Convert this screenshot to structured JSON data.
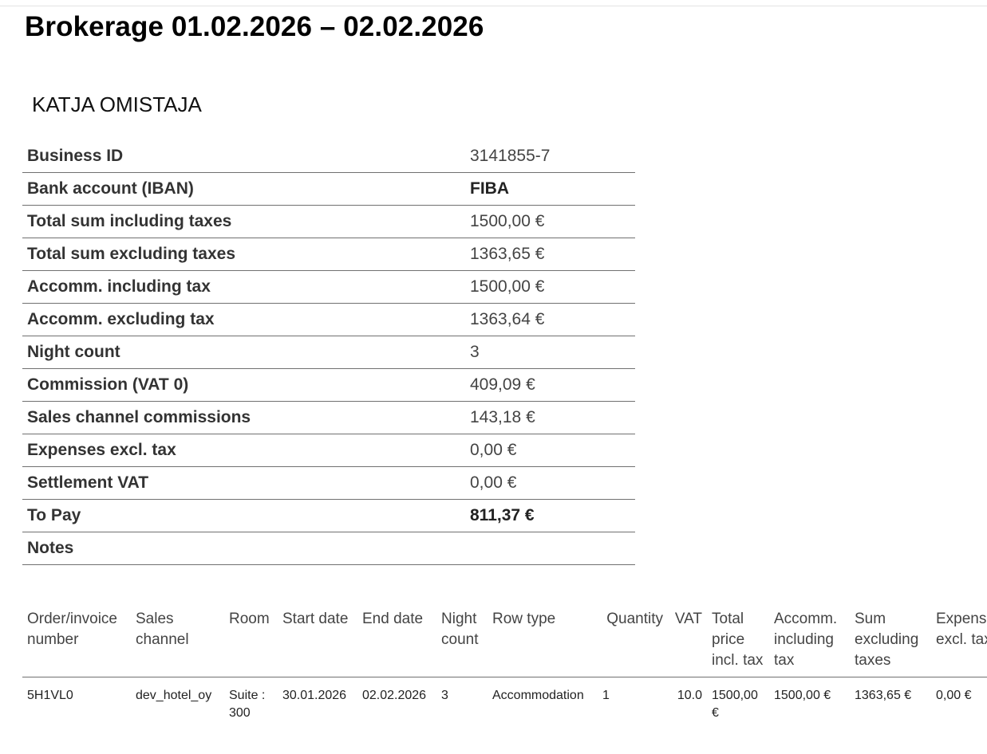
{
  "title": "Brokerage 01.02.2026 – 02.02.2026",
  "owner_name": "KATJA OMISTAJA",
  "summary": [
    {
      "label": "Business ID",
      "value": "3141855-7"
    },
    {
      "label": "Bank account (IBAN)",
      "value": "FIBA"
    },
    {
      "label": "Total sum including taxes",
      "value": "1500,00 €"
    },
    {
      "label": "Total sum excluding taxes",
      "value": "1363,65 €"
    },
    {
      "label": "Accomm. including tax",
      "value": "1500,00 €"
    },
    {
      "label": "Accomm. excluding tax",
      "value": "1363,64 €"
    },
    {
      "label": "Night count",
      "value": "3"
    },
    {
      "label": "Commission (VAT 0)",
      "value": "409,09 €"
    },
    {
      "label": "Sales channel commissions",
      "value": "143,18 €"
    },
    {
      "label": "Expenses excl. tax",
      "value": "0,00 €"
    },
    {
      "label": "Settlement VAT",
      "value": "0,00 €"
    },
    {
      "label": "To Pay",
      "value": "811,37 €"
    },
    {
      "label": "Notes",
      "value": ""
    }
  ],
  "rows_table": {
    "headers": [
      "Order/invoice number",
      "Sales channel",
      "Room",
      "Start date",
      "End date",
      "Night count",
      "Row type",
      "Quantity",
      "VAT",
      "Total price incl. tax",
      "Accomm. including tax",
      "Sum excluding taxes",
      "Expenses excl. tax"
    ],
    "rows": [
      [
        "5H1VL0",
        "dev_hotel_oy",
        "Suite : 300",
        "30.01.2026",
        "02.02.2026",
        "3",
        "Accommodation",
        "1",
        "10.0",
        "1500,00 €",
        "1500,00 €",
        "1363,65 €",
        "0,00 €"
      ]
    ]
  }
}
